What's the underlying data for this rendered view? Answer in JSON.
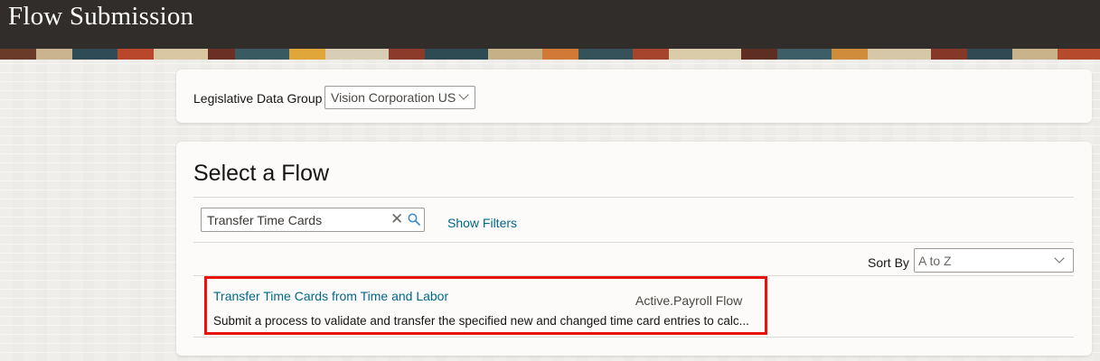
{
  "header": {
    "title": "Flow Submission"
  },
  "ldg": {
    "label": "Legislative Data Group",
    "value": "Vision Corporation US"
  },
  "flow": {
    "heading": "Select a Flow",
    "search": {
      "value": "Transfer Time Cards"
    },
    "show_filters": "Show Filters",
    "sort": {
      "label": "Sort By",
      "value": "A to Z"
    },
    "results": [
      {
        "title": "Transfer Time Cards from Time and Labor",
        "status": "Active.Payroll Flow",
        "description": "Submit a process to validate and transfer the specified new and changed time card entries to calc..."
      }
    ]
  },
  "colors": {
    "highlight": "#e8120c",
    "link": "#00688c",
    "header_bg": "#312d2a"
  }
}
